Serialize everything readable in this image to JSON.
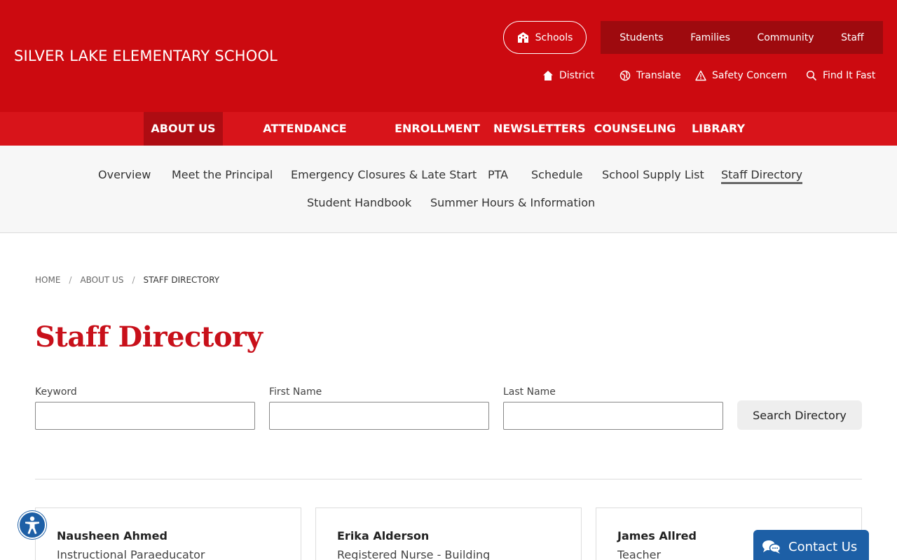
{
  "header": {
    "site_title": "SILVER LAKE ELEMENTARY SCHOOL",
    "schools_label": "Schools",
    "audience": [
      "Students",
      "Families",
      "Community",
      "Staff"
    ],
    "utility": {
      "district": "District",
      "translate": "Translate",
      "safety": "Safety Concern",
      "find": "Find It Fast"
    }
  },
  "main_nav": [
    "ABOUT US",
    "ATTENDANCE REPORTING",
    "ENROLLMENT",
    "NEWSLETTERS",
    "COUNSELING",
    "LIBRARY"
  ],
  "sub_nav": [
    "Overview",
    "Meet the Principal",
    "Emergency Closures & Late Start",
    "PTA",
    "Schedule",
    "School Supply List",
    "Staff Directory",
    "Student Handbook",
    "Summer Hours & Information"
  ],
  "breadcrumb": [
    "HOME",
    "ABOUT US",
    "STAFF DIRECTORY"
  ],
  "page_title": "Staff Directory",
  "search": {
    "keyword_label": "Keyword",
    "keyword_value": "",
    "first_label": "First Name",
    "first_value": "",
    "last_label": "Last Name",
    "last_value": "",
    "button": "Search Directory"
  },
  "staff": [
    {
      "name": "Nausheen Ahmed",
      "role": "Instructional Paraeducator"
    },
    {
      "name": "Erika Alderson",
      "role": "Registered Nurse - Building"
    },
    {
      "name": "James Allred",
      "role": "Teacher"
    }
  ],
  "contact_label": "Contact Us",
  "colors": {
    "brand_red": "#cc0a10",
    "title_red": "#c8101a",
    "accent_blue": "#1d5fa6"
  }
}
